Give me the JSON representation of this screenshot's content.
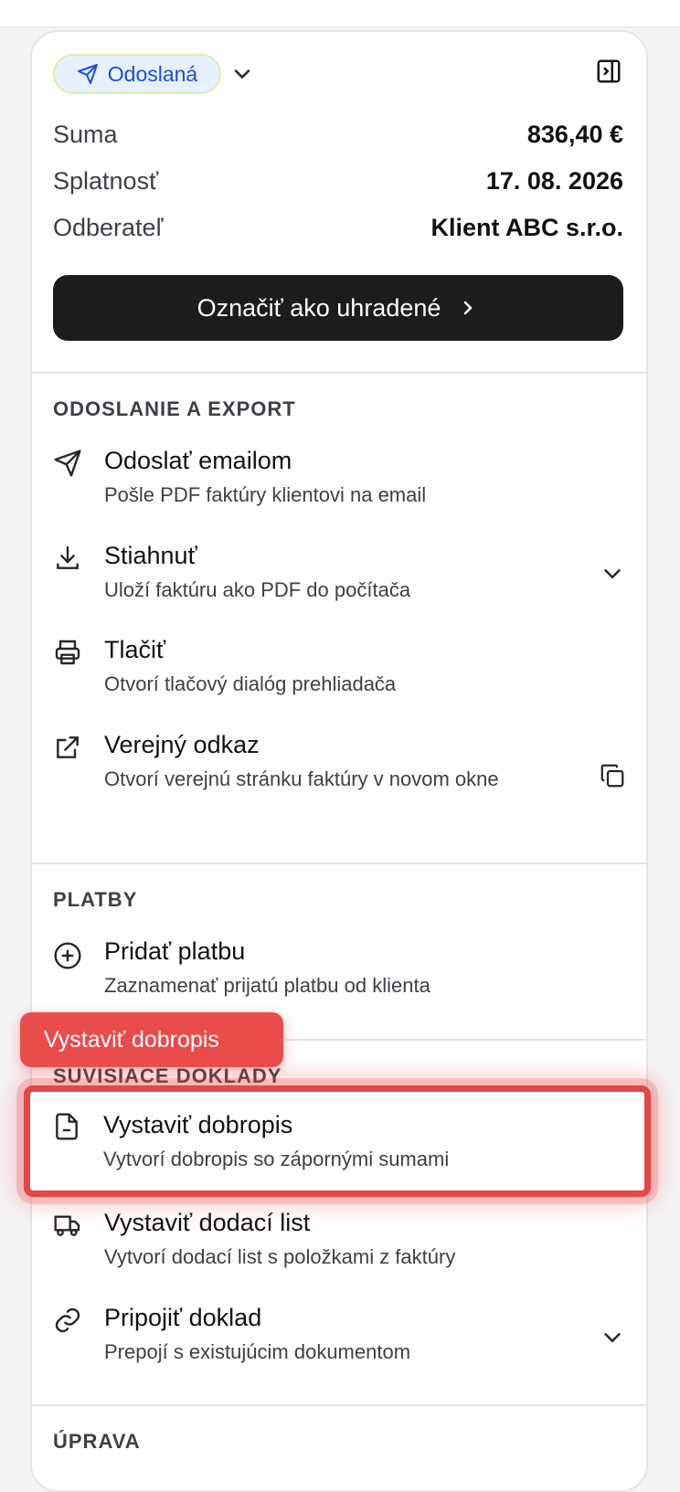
{
  "header": {
    "status_label": "Odoslaná",
    "summary": [
      {
        "label": "Suma",
        "value": "836,40 €"
      },
      {
        "label": "Splatnosť",
        "value": "17. 08. 2026"
      },
      {
        "label": "Odberateľ",
        "value": "Klient ABC s.r.o."
      }
    ],
    "primary_action": "Označiť ako uhradené"
  },
  "sections": {
    "export": {
      "title": "ODOSLANIE A EXPORT",
      "items": [
        {
          "title": "Odoslať emailom",
          "desc": "Pošle PDF faktúry klientovi na email",
          "icon": "send-icon"
        },
        {
          "title": "Stiahnuť",
          "desc": "Uloží faktúru ako PDF do počítača",
          "icon": "download-icon"
        },
        {
          "title": "Tlačiť",
          "desc": "Otvorí tlačový dialóg prehliadača",
          "icon": "printer-icon"
        },
        {
          "title": "Verejný odkaz",
          "desc": "Otvorí verejnú stránku faktúry v novom okne",
          "icon": "external-link-icon"
        }
      ]
    },
    "payments": {
      "title": "PLATBY",
      "items": [
        {
          "title": "Pridať platbu",
          "desc": "Zaznamenať prijatú platbu od klienta",
          "icon": "plus-circle-icon"
        }
      ]
    },
    "related": {
      "title": "SÚVISIACE DOKLADY",
      "items": [
        {
          "title": "Vystaviť dobropis",
          "desc": "Vytvorí dobropis so zápornými sumami",
          "icon": "file-minus-icon"
        },
        {
          "title": "Vystaviť dodací list",
          "desc": "Vytvorí dodací list s položkami z faktúry",
          "icon": "truck-icon"
        },
        {
          "title": "Pripojiť doklad",
          "desc": "Prepojí s existujúcim dokumentom",
          "icon": "link-icon"
        }
      ]
    },
    "edit": {
      "title": "ÚPRAVA"
    }
  },
  "tooltip": {
    "label": "Vystaviť dobropis"
  },
  "colors": {
    "accent_red": "#ea4c4c",
    "status_blue": "#1d4ed8",
    "primary_dark": "#1c1c1c"
  }
}
